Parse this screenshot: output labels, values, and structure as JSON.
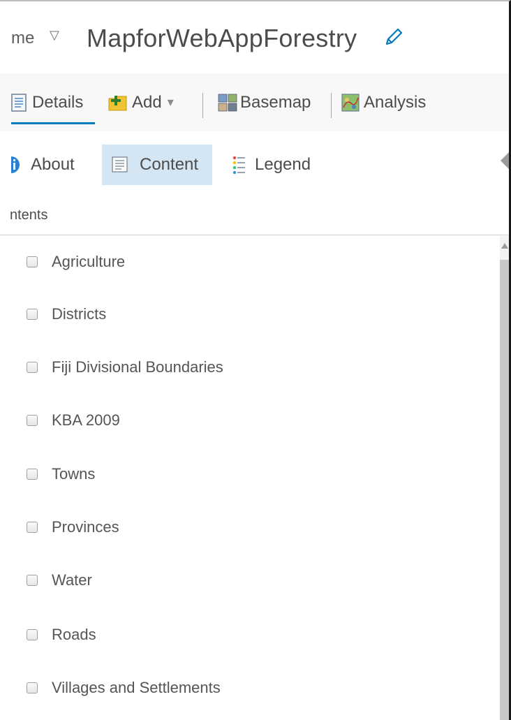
{
  "header": {
    "home_label": "me",
    "home_caret": "▽",
    "map_title": "MapforWebAppForestry",
    "edit_icon": "pencil-icon"
  },
  "toolbar": {
    "details_label": "Details",
    "add_label": "Add",
    "add_caret": "▾",
    "basemap_label": "Basemap",
    "analysis_label": "Analysis",
    "accent_color": "#0079c1"
  },
  "tabs": {
    "about_label": "About",
    "content_label": "Content",
    "legend_label": "Legend",
    "active": "Content"
  },
  "contents": {
    "heading": "ntents",
    "layers": [
      {
        "label": "Agriculture",
        "checked": false
      },
      {
        "label": "Districts",
        "checked": false
      },
      {
        "label": "Fiji Divisional Boundaries",
        "checked": false
      },
      {
        "label": "KBA 2009",
        "checked": false
      },
      {
        "label": "Towns",
        "checked": false
      },
      {
        "label": "Provinces",
        "checked": false
      },
      {
        "label": "Water",
        "checked": false
      },
      {
        "label": "Roads",
        "checked": false
      },
      {
        "label": "Villages and Settlements",
        "checked": false
      }
    ]
  }
}
